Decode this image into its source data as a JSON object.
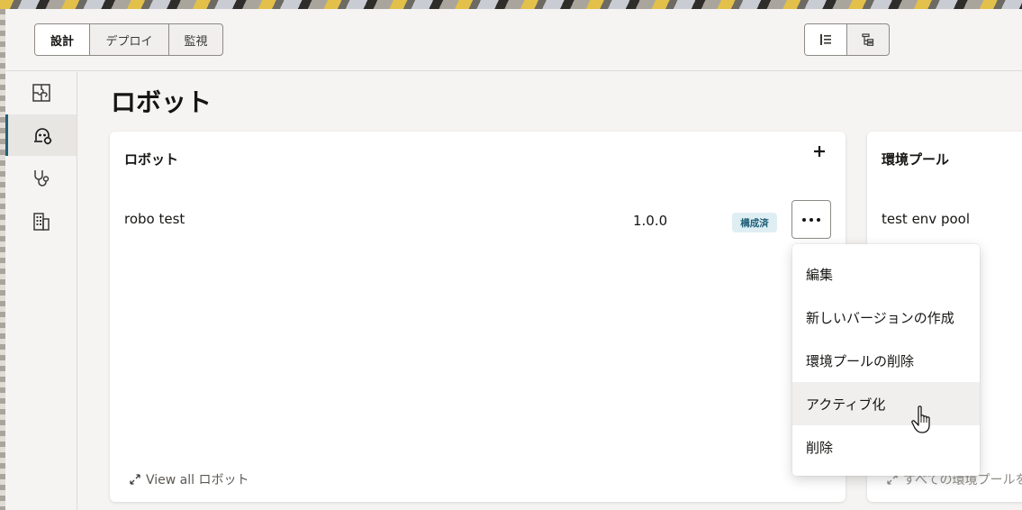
{
  "topbar": {
    "mode_tabs": [
      {
        "label": "設計",
        "active": true
      },
      {
        "label": "デプロイ",
        "active": false
      },
      {
        "label": "監視",
        "active": false
      }
    ],
    "view_toggle": [
      {
        "icon": "list-view-icon",
        "active": true
      },
      {
        "icon": "tree-view-icon",
        "active": false
      }
    ]
  },
  "sidenav": {
    "items": [
      {
        "icon": "puzzle-icon",
        "active": false
      },
      {
        "icon": "robot-icon",
        "active": true
      },
      {
        "icon": "stethoscope-icon",
        "active": false
      },
      {
        "icon": "building-icon",
        "active": false
      }
    ]
  },
  "page": {
    "title": "ロボット"
  },
  "robot_card": {
    "title": "ロボット",
    "add_icon": "plus-icon",
    "rows": [
      {
        "name": "robo test",
        "version": "1.0.0",
        "status": "構成済"
      }
    ],
    "view_all": "View all ロボット"
  },
  "env_card": {
    "title": "環境プール",
    "rows": [
      {
        "name": "test env pool"
      }
    ],
    "footer": "すべての環境プールを"
  },
  "context_menu": {
    "items": [
      {
        "label": "編集"
      },
      {
        "label": "新しいバージョンの作成"
      },
      {
        "label": "環境プールの削除"
      },
      {
        "label": "アクティブ化",
        "hover": true
      },
      {
        "label": "削除"
      }
    ]
  },
  "colors": {
    "accent": "#22617a",
    "badge_bg": "#dfeef3",
    "background": "#f5f4f2"
  }
}
